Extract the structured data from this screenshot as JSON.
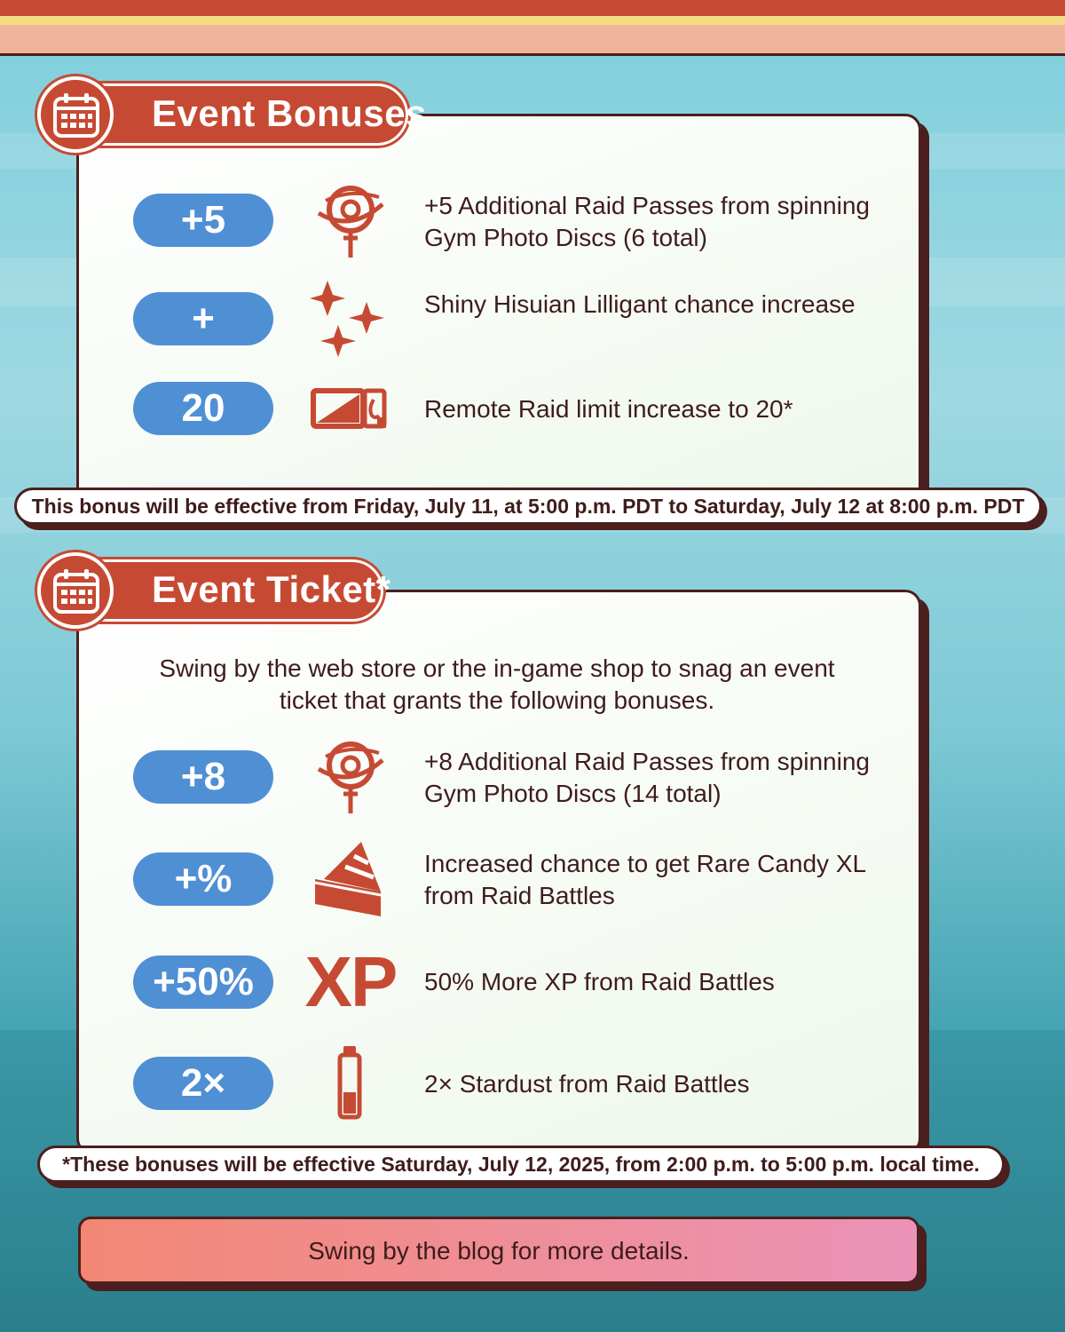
{
  "colors": {
    "brand_red": "#c64a33",
    "badge_blue": "#4f8fd4",
    "outline": "#4a1f1e",
    "text": "#3e1c1c"
  },
  "event_bonuses": {
    "title": "Event Bonuses",
    "items": [
      {
        "badge": "+5",
        "icon": "raid-pass-icon",
        "text": "+5 Additional Raid Passes from spinning Gym Photo Discs (6 total)"
      },
      {
        "badge": "+",
        "icon": "sparkles-icon",
        "text": "Shiny Hisuian Lilligant chance increase"
      },
      {
        "badge": "20",
        "icon": "remote-raid-pass-icon",
        "text": "Remote Raid limit increase to 20*"
      }
    ],
    "notice": "This bonus will be effective from Friday, July 11, at 5:00 p.m. PDT to Saturday, July 12 at 8:00 p.m. PDT"
  },
  "event_ticket": {
    "title": "Event Ticket*",
    "intro": "Swing by the web store or the in-game shop to snag an event ticket that grants the following bonuses.",
    "items": [
      {
        "badge": "+8",
        "icon": "raid-pass-icon",
        "text": "+8 Additional Raid Passes from spinning Gym Photo Discs (14 total)"
      },
      {
        "badge": "+%",
        "icon": "rare-candy-xl-icon",
        "text": "Increased chance to get Rare Candy XL from Raid Battles"
      },
      {
        "badge": "+50%",
        "icon": "xp-icon",
        "icon_text": "XP",
        "text": "50% More XP from Raid Battles"
      },
      {
        "badge": "2×",
        "icon": "stardust-icon",
        "text": "2× Stardust from Raid Battles"
      }
    ],
    "notice": "*These bonuses will be effective Saturday, July 12, 2025, from 2:00 p.m. to 5:00 p.m. local time."
  },
  "footer": {
    "label": "Swing by the blog for more details."
  }
}
